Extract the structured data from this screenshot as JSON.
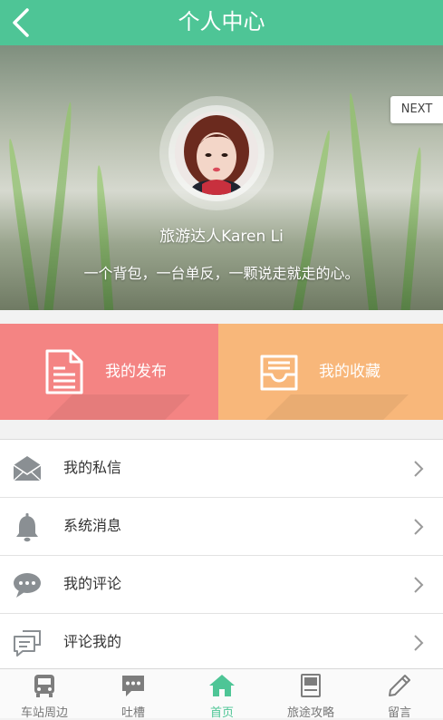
{
  "header": {
    "title": "个人中心",
    "back_icon": "chevron-left-icon"
  },
  "hero": {
    "next_label": "NEXT",
    "username": "旅游达人Karen Li",
    "motto": "一个背包，一台单反，一颗说走就走的心。"
  },
  "tiles": [
    {
      "label": "我的发布",
      "icon": "document-icon",
      "color": "#f48483"
    },
    {
      "label": "我的收藏",
      "icon": "inbox-tray-icon",
      "color": "#f8b77a"
    }
  ],
  "menu": [
    {
      "label": "我的私信",
      "icon": "envelope-icon"
    },
    {
      "label": "系统消息",
      "icon": "bell-icon"
    },
    {
      "label": "我的评论",
      "icon": "speech-bubble-icon"
    },
    {
      "label": "评论我的",
      "icon": "comment-lines-icon"
    }
  ],
  "tabbar": {
    "accent": "#4ec596",
    "items": [
      {
        "label": "车站周边",
        "icon": "bus-icon",
        "active": false
      },
      {
        "label": "吐槽",
        "icon": "chat-icon",
        "active": false
      },
      {
        "label": "首页",
        "icon": "home-icon",
        "active": true
      },
      {
        "label": "旅途攻略",
        "icon": "book-icon",
        "active": false
      },
      {
        "label": "留言",
        "icon": "pencil-icon",
        "active": false
      }
    ]
  }
}
